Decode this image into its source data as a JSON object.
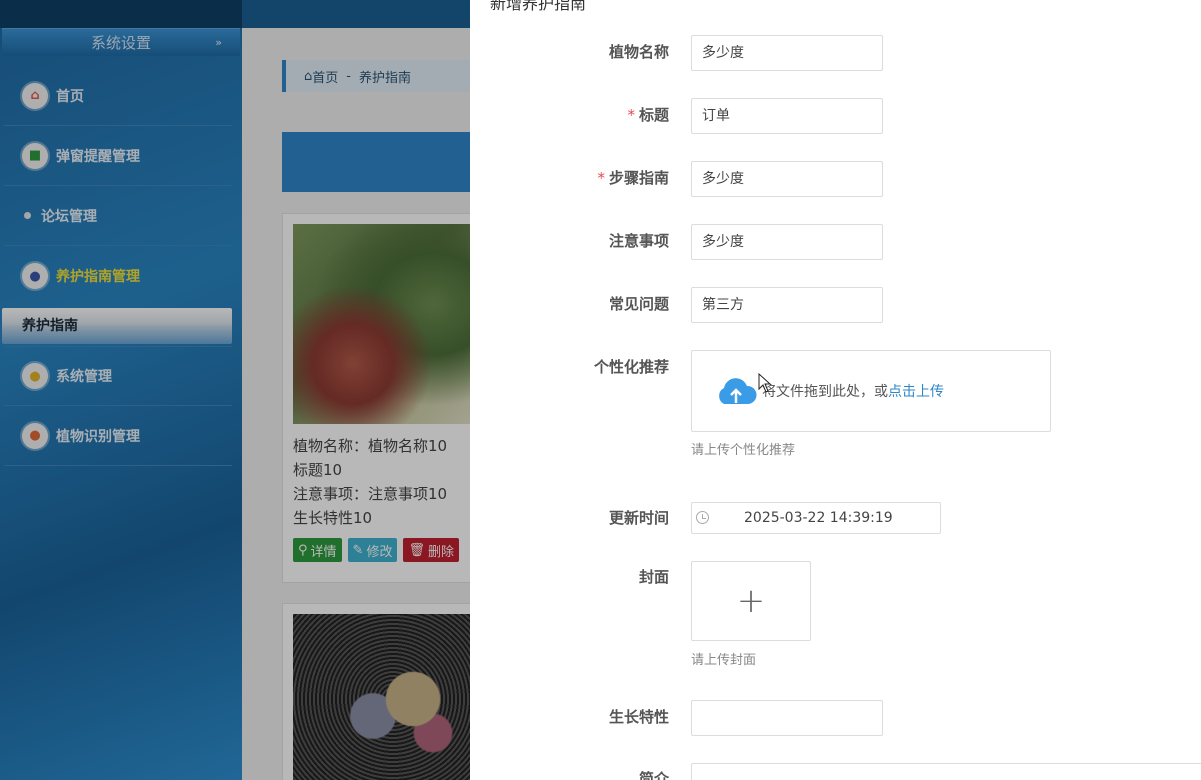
{
  "sidebar": {
    "section_title": "系统设置",
    "section_chevron": "»",
    "items": [
      {
        "label": "首页",
        "icon": "home-icon",
        "icon_glyph": "⌂",
        "icon_color": "#e25b4a"
      },
      {
        "label": "弹窗提醒管理",
        "icon": "gift-icon",
        "icon_glyph": "■",
        "icon_color": "#2f9a3e"
      },
      {
        "label": "论坛管理",
        "icon": "dot-icon"
      },
      {
        "label": "养护指南管理",
        "icon": "users-icon",
        "icon_glyph": "●",
        "icon_color": "#3b58a8",
        "highlight": true
      },
      {
        "label": "系统管理",
        "icon": "settings-icon",
        "icon_glyph": "●",
        "icon_color": "#e0b52a"
      },
      {
        "label": "植物识别管理",
        "icon": "chat-icon",
        "icon_glyph": "●",
        "icon_color": "#e0683a"
      }
    ],
    "active_sub": "养护指南"
  },
  "main": {
    "breadcrumb_home": "首页",
    "breadcrumb_sep": "-",
    "breadcrumb_current": "养护指南",
    "card": {
      "plant_name": "植物名称：植物名称10",
      "title": "标题10",
      "notes": "注意事项：注意事项10",
      "growth": "生长特性10",
      "btn_detail": "详情",
      "btn_edit": "修改",
      "btn_delete": "删除"
    }
  },
  "drawer": {
    "title": "新增养护指南",
    "fields": {
      "plant_name": {
        "label": "植物名称",
        "value": "多少度"
      },
      "title": {
        "label": "标题",
        "value": "订单",
        "required": true
      },
      "steps": {
        "label": "步骤指南",
        "value": "多少度",
        "required": true
      },
      "notes": {
        "label": "注意事项",
        "value": "多少度"
      },
      "faq": {
        "label": "常见问题",
        "value": "第三方"
      },
      "recommend": {
        "label": "个性化推荐",
        "drop_text": "将文件拖到此处，或",
        "link_text": "点击上传",
        "hint": "请上传个性化推荐"
      },
      "update_time": {
        "label": "更新时间",
        "value": "2025-03-22 14:39:19"
      },
      "cover": {
        "label": "封面",
        "plus": "+",
        "hint": "请上传封面"
      },
      "growth": {
        "label": "生长特性",
        "value": ""
      },
      "intro": {
        "label": "简介"
      }
    },
    "required_mark": "*"
  },
  "colors": {
    "accent": "#2f86c9",
    "required": "#e84a4a",
    "sidebar": "#1f6aa3"
  }
}
